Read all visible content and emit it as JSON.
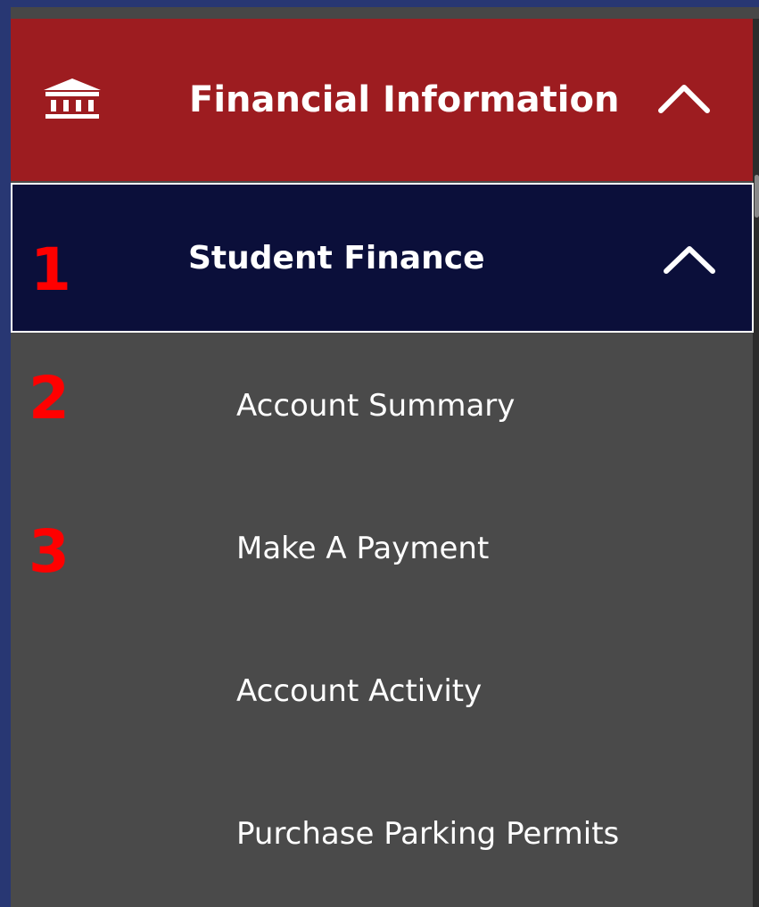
{
  "colors": {
    "outer_background": "#283773",
    "financial_header_bg": "#9d1c20",
    "student_finance_bg": "#0b0f3a",
    "menu_bg": "#4a4a4a",
    "text": "#ffffff",
    "marker": "#ff0000"
  },
  "financial_information": {
    "icon": "bank-icon",
    "title": "Financial Information",
    "toggle_icon": "chevron-up-icon",
    "expanded": true
  },
  "student_finance": {
    "title": "Student Finance",
    "toggle_icon": "chevron-up-icon",
    "expanded": true
  },
  "menu_items": [
    {
      "label": "Account Summary"
    },
    {
      "label": "Make A Payment"
    },
    {
      "label": "Account Activity"
    },
    {
      "label": "Purchase Parking Permits"
    }
  ],
  "markers": [
    "1",
    "2",
    "3"
  ]
}
